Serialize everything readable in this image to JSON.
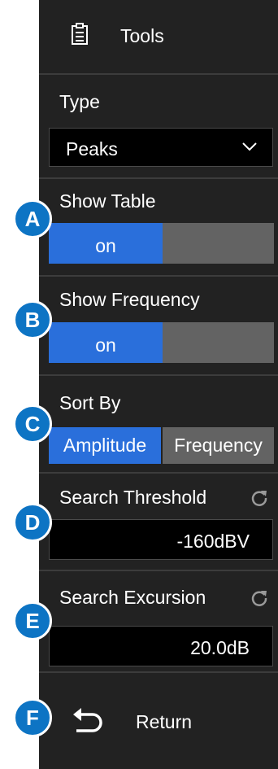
{
  "header": {
    "icon": "clipboard-icon",
    "title": "Tools"
  },
  "type": {
    "label": "Type",
    "value": "Peaks",
    "icon": "chevron-down-icon"
  },
  "show_table": {
    "label": "Show Table",
    "state": "on"
  },
  "show_frequency": {
    "label": "Show Frequency",
    "state": "on"
  },
  "sort_by": {
    "label": "Sort By",
    "options": [
      "Amplitude",
      "Frequency"
    ],
    "selected": "Amplitude"
  },
  "search_threshold": {
    "label": "Search Threshold",
    "value": "-160dBV",
    "icon": "reset-icon"
  },
  "search_excursion": {
    "label": "Search Excursion",
    "value": "20.0dB",
    "icon": "reset-icon"
  },
  "return_item": {
    "label": "Return",
    "icon": "return-arrow-icon"
  },
  "badges": [
    "A",
    "B",
    "C",
    "D",
    "E",
    "F"
  ],
  "colors": {
    "panel": "#222222",
    "accent": "#2a6fdb",
    "inactive": "#636363",
    "badge": "#0d74c4",
    "field": "#000000"
  }
}
